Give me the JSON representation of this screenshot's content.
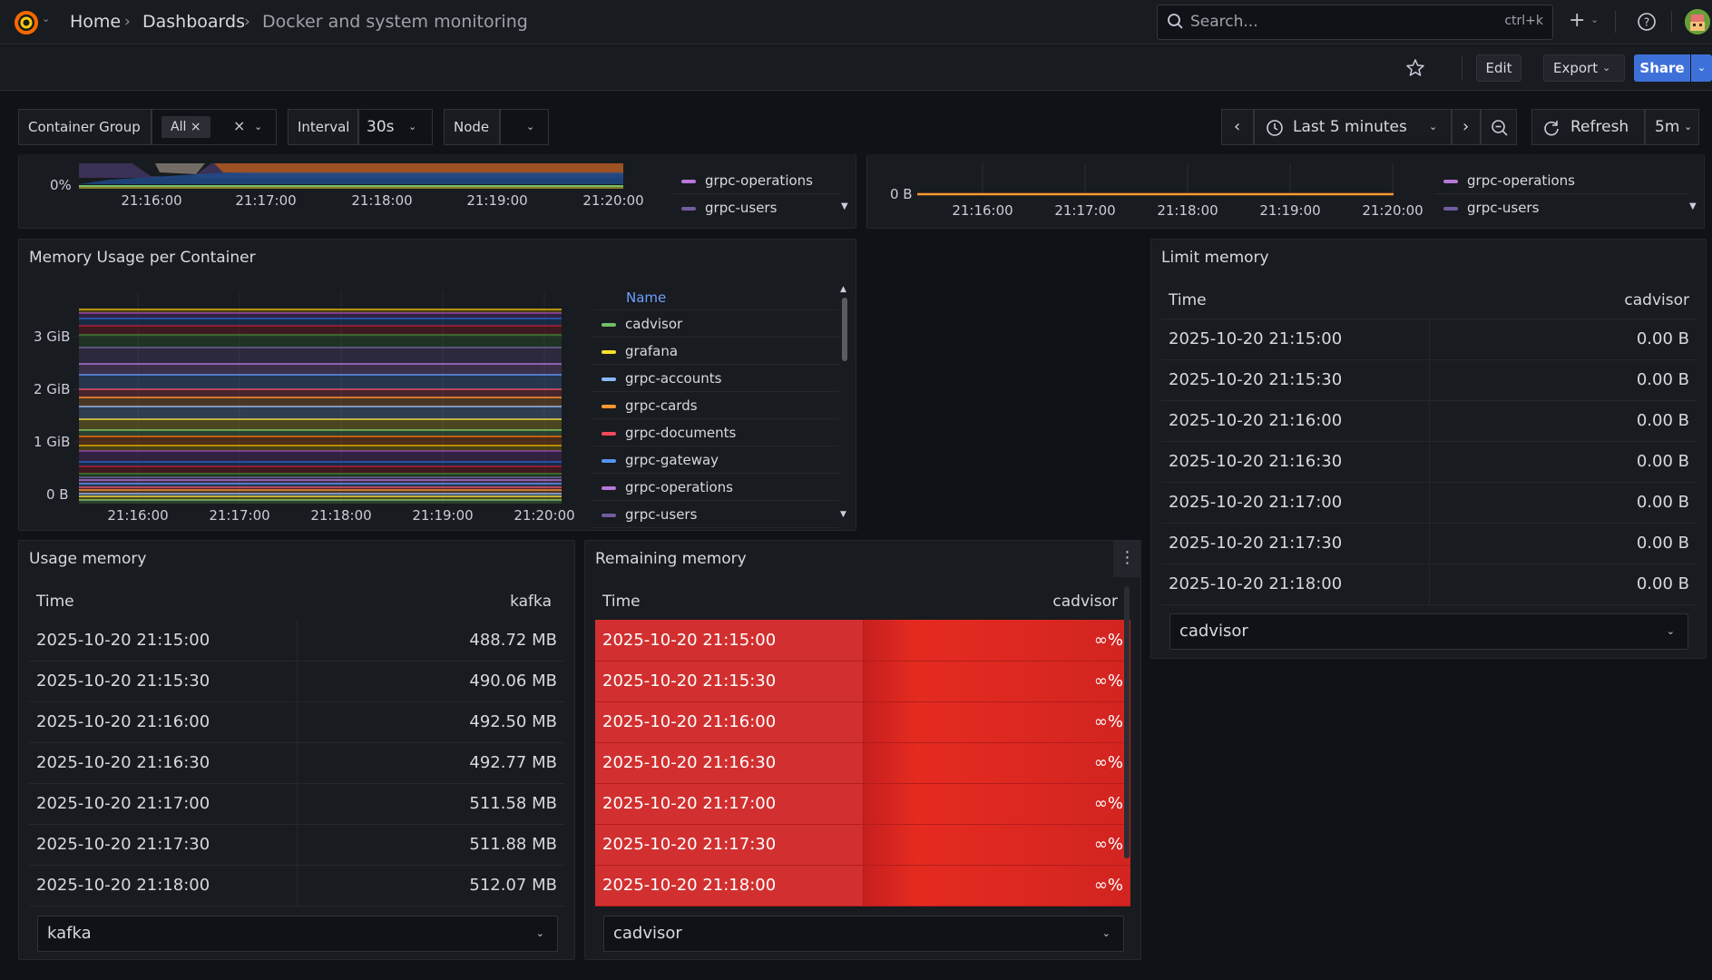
{
  "nav": {
    "breadcrumbs": [
      "Home",
      "Dashboards",
      "Docker and system monitoring"
    ],
    "search_placeholder": "Search...",
    "search_shortcut": "ctrl+k"
  },
  "actions": {
    "edit": "Edit",
    "export": "Export",
    "share": "Share"
  },
  "variables": {
    "group": {
      "label": "Container Group",
      "value": "All"
    },
    "interval": {
      "label": "Interval",
      "value": "30s"
    },
    "node": {
      "label": "Node",
      "value": ""
    }
  },
  "time": {
    "range": "Last 5 minutes",
    "refresh": "Refresh",
    "refresh_interval": "5m"
  },
  "top_left_panel": {
    "y_tick": "0%",
    "x_ticks": [
      "21:16:00",
      "21:17:00",
      "21:18:00",
      "21:19:00",
      "21:20:00"
    ],
    "legend": [
      "grpc-operations",
      "grpc-users"
    ]
  },
  "top_right_panel": {
    "y_tick": "0 B",
    "x_ticks": [
      "21:16:00",
      "21:17:00",
      "21:18:00",
      "21:19:00",
      "21:20:00"
    ],
    "legend": [
      "grpc-operations",
      "grpc-users"
    ]
  },
  "memory_panel": {
    "title": "Memory Usage per Container",
    "legend_header": "Name",
    "y_ticks": [
      "3 GiB",
      "2 GiB",
      "1 GiB",
      "0 B"
    ],
    "x_ticks": [
      "21:16:00",
      "21:17:00",
      "21:18:00",
      "21:19:00",
      "21:20:00"
    ],
    "legend": [
      {
        "name": "cadvisor",
        "color": "#73bf69"
      },
      {
        "name": "grafana",
        "color": "#fade2a"
      },
      {
        "name": "grpc-accounts",
        "color": "#8ab8ff"
      },
      {
        "name": "grpc-cards",
        "color": "#ff9830"
      },
      {
        "name": "grpc-documents",
        "color": "#f2495c"
      },
      {
        "name": "grpc-gateway",
        "color": "#5794f2"
      },
      {
        "name": "grpc-operations",
        "color": "#b877d9"
      },
      {
        "name": "grpc-users",
        "color": "#705da0"
      }
    ]
  },
  "limit_panel": {
    "title": "Limit memory",
    "col_time": "Time",
    "col_value": "cadvisor",
    "rows": [
      [
        "2025-10-20 21:15:00",
        "0.00 B"
      ],
      [
        "2025-10-20 21:15:30",
        "0.00 B"
      ],
      [
        "2025-10-20 21:16:00",
        "0.00 B"
      ],
      [
        "2025-10-20 21:16:30",
        "0.00 B"
      ],
      [
        "2025-10-20 21:17:00",
        "0.00 B"
      ],
      [
        "2025-10-20 21:17:30",
        "0.00 B"
      ],
      [
        "2025-10-20 21:18:00",
        "0.00 B"
      ]
    ],
    "footer": "cadvisor"
  },
  "usage_panel": {
    "title": "Usage memory",
    "col_time": "Time",
    "col_value": "kafka",
    "rows": [
      [
        "2025-10-20 21:15:00",
        "488.72 MB"
      ],
      [
        "2025-10-20 21:15:30",
        "490.06 MB"
      ],
      [
        "2025-10-20 21:16:00",
        "492.50 MB"
      ],
      [
        "2025-10-20 21:16:30",
        "492.77 MB"
      ],
      [
        "2025-10-20 21:17:00",
        "511.58 MB"
      ],
      [
        "2025-10-20 21:17:30",
        "511.88 MB"
      ],
      [
        "2025-10-20 21:18:00",
        "512.07 MB"
      ]
    ],
    "footer": "kafka"
  },
  "remaining_panel": {
    "title": "Remaining memory",
    "col_time": "Time",
    "col_value": "cadvisor",
    "rows": [
      [
        "2025-10-20 21:15:00",
        "∞%"
      ],
      [
        "2025-10-20 21:15:30",
        "∞%"
      ],
      [
        "2025-10-20 21:16:00",
        "∞%"
      ],
      [
        "2025-10-20 21:16:30",
        "∞%"
      ],
      [
        "2025-10-20 21:17:00",
        "∞%"
      ],
      [
        "2025-10-20 21:17:30",
        "∞%"
      ],
      [
        "2025-10-20 21:18:00",
        "∞%"
      ]
    ],
    "footer": "cadvisor"
  }
}
